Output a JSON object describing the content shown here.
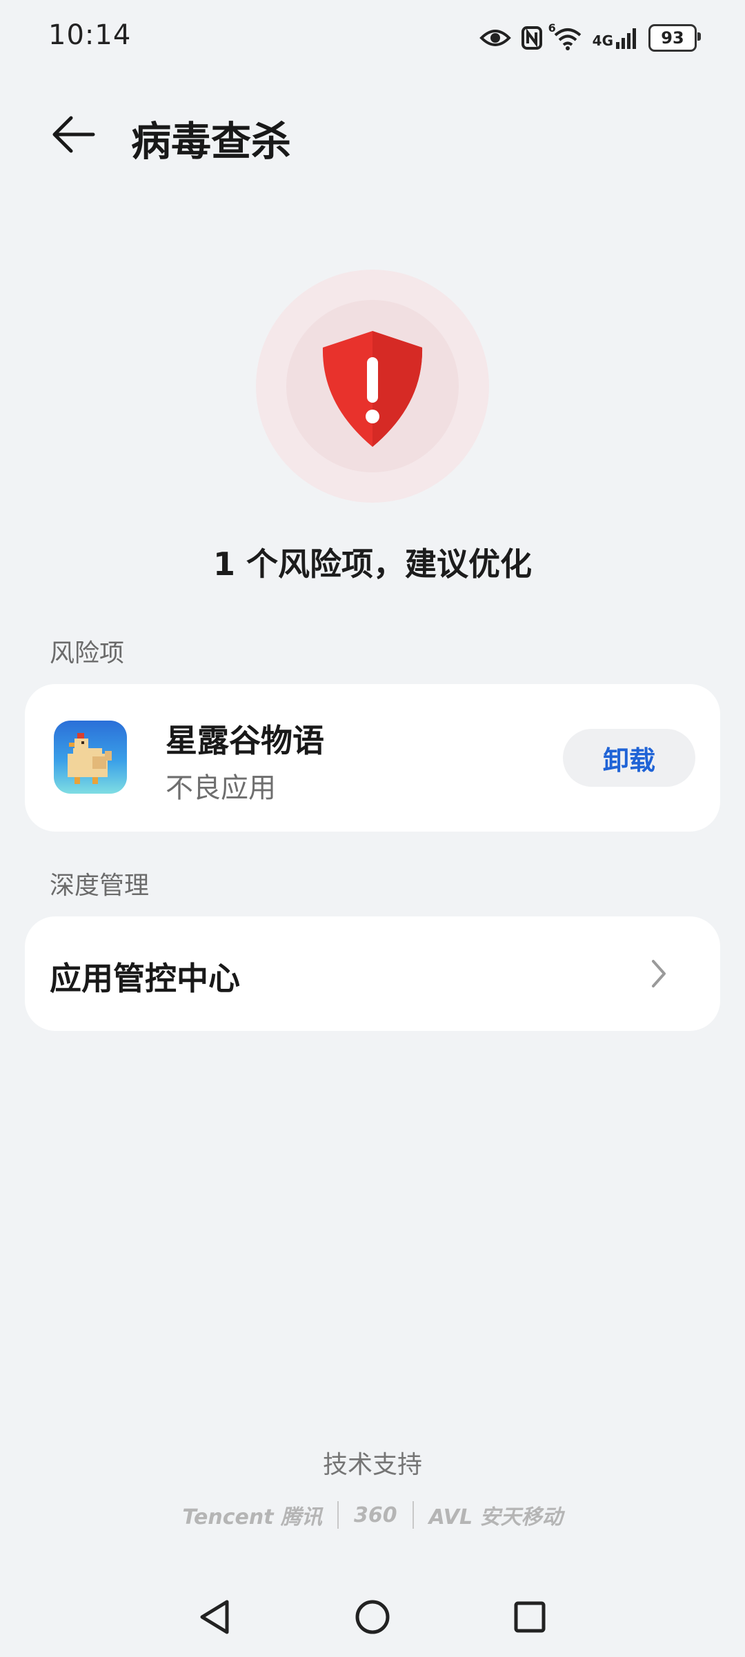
{
  "status_bar": {
    "time": "10:14",
    "network": "4G",
    "wifi_superscript": "6",
    "battery": "93"
  },
  "header": {
    "title": "病毒查杀",
    "back_icon": "arrow-left-icon"
  },
  "hero": {
    "icon": "shield-alert-icon",
    "summary": "1 个风险项，建议优化",
    "accent_color": "#e8322c"
  },
  "risk_section": {
    "label": "风险项",
    "items": [
      {
        "name": "星露谷物语",
        "tag": "不良应用",
        "action": "卸载"
      }
    ]
  },
  "deep_section": {
    "label": "深度管理",
    "items": [
      {
        "label": "应用管控中心"
      }
    ]
  },
  "footer": {
    "support_label": "技术支持",
    "partners": [
      "Tencent 腾讯",
      "360",
      "AVL 安天移动"
    ]
  },
  "nav": {
    "back": "triangle-back-icon",
    "home": "circle-home-icon",
    "recents": "square-recents-icon"
  },
  "colors": {
    "background": "#f1f3f5",
    "card": "#ffffff",
    "link": "#1f63d6"
  }
}
